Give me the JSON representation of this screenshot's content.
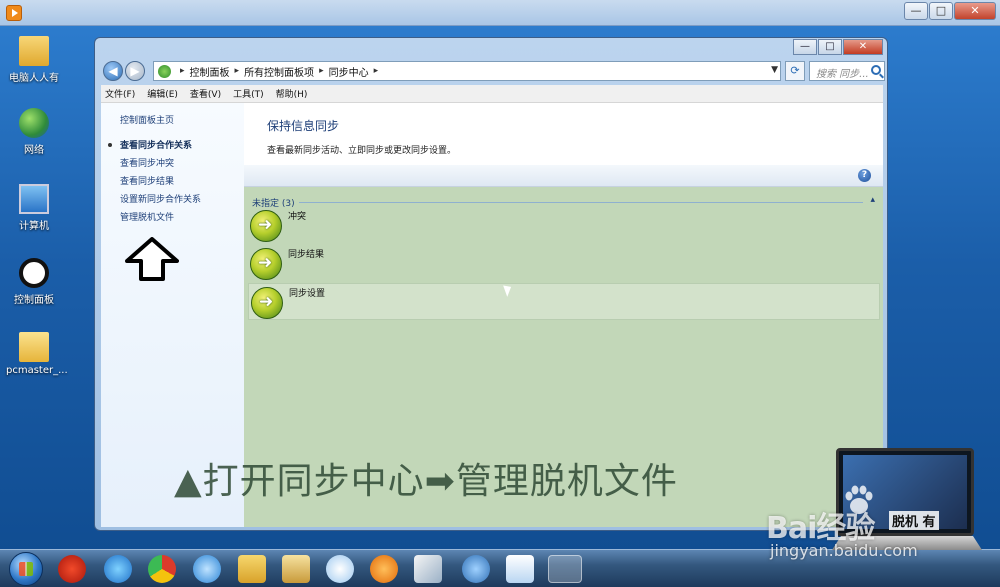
{
  "desktop": {
    "icons": [
      {
        "label": "电脑人人有",
        "icon": "folder-icon"
      },
      {
        "label": "网络",
        "icon": "network-icon"
      },
      {
        "label": "计算机",
        "icon": "computer-icon"
      },
      {
        "label": "控制面板",
        "icon": "panda-icon"
      },
      {
        "label": "pcmaster_...",
        "icon": "file-icon"
      }
    ]
  },
  "outer_window": {
    "controls": {
      "minimize": "—",
      "maximize": "□",
      "close": "✕"
    }
  },
  "window": {
    "controls": {
      "minimize": "—",
      "maximize": "□",
      "close": "✕"
    },
    "address": {
      "breadcrumbs": [
        "控制面板",
        "所有控制面板项",
        "同步中心"
      ],
      "search_placeholder": "搜索 同步..."
    },
    "menu": [
      "文件(F)",
      "编辑(E)",
      "查看(V)",
      "工具(T)",
      "帮助(H)"
    ],
    "left_pane": {
      "home_link": "控制面板主页",
      "links": [
        {
          "label": "查看同步合作关系",
          "active": true
        },
        {
          "label": "查看同步冲突",
          "active": false
        },
        {
          "label": "查看同步结果",
          "active": false
        },
        {
          "label": "设置新同步合作关系",
          "active": false
        },
        {
          "label": "管理脱机文件",
          "active": false
        }
      ]
    },
    "right_pane": {
      "title": "保持信息同步",
      "description": "查看最新同步活动、立即同步或更改同步设置。",
      "help_icon": "?",
      "group": {
        "label": "未指定 (3)",
        "chevron": "▴"
      },
      "items": [
        {
          "label": "冲突",
          "icon": "sync-icon"
        },
        {
          "label": "同步结果",
          "icon": "sync-icon"
        },
        {
          "label": "同步设置",
          "icon": "sync-icon",
          "selected": true
        }
      ]
    }
  },
  "caption": "▲打开同步中心➡管理脱机文件",
  "watermark": {
    "laptop_text": "脱机    有",
    "logo": "Bai经验",
    "url": "jingyan.baidu.com"
  },
  "taskbar": {
    "apps": [
      "start-orb",
      "chess-icon",
      "ie-icon",
      "chrome-icon",
      "qq-browser-icon",
      "folder-icon",
      "explorer-icon",
      "pinwheel-icon",
      "media-icon",
      "paint-icon",
      "video-icon",
      "box-icon",
      "control-panel-icon"
    ]
  }
}
